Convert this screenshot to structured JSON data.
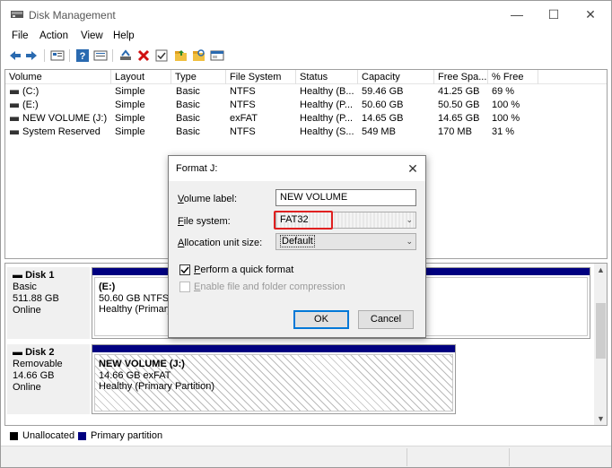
{
  "window": {
    "title": "Disk Management",
    "minimize": "—",
    "maximize": "☐",
    "close": "✕"
  },
  "menu": [
    "File",
    "Action",
    "View",
    "Help"
  ],
  "toolbar_icons": [
    "back-arrow-icon",
    "forward-arrow-icon",
    "disk-list-icon",
    "help-icon",
    "properties-icon",
    "connect-icon",
    "delete-icon",
    "checkmark-icon",
    "folder-up-icon",
    "folder-search-icon",
    "console-icon"
  ],
  "volume_list": {
    "columns": [
      "Volume",
      "Layout",
      "Type",
      "File System",
      "Status",
      "Capacity",
      "Free Spa...",
      "% Free"
    ],
    "rows": [
      [
        "(C:)",
        "Simple",
        "Basic",
        "NTFS",
        "Healthy (B...",
        "59.46 GB",
        "41.25 GB",
        "69 %"
      ],
      [
        "(E:)",
        "Simple",
        "Basic",
        "NTFS",
        "Healthy (P...",
        "50.60 GB",
        "50.50 GB",
        "100 %"
      ],
      [
        "NEW VOLUME (J:)",
        "Simple",
        "Basic",
        "exFAT",
        "Healthy (P...",
        "14.65 GB",
        "14.65 GB",
        "100 %"
      ],
      [
        "System Reserved",
        "Simple",
        "Basic",
        "NTFS",
        "Healthy (S...",
        "549 MB",
        "170 MB",
        "31 %"
      ]
    ]
  },
  "disks": [
    {
      "name": "Disk 1",
      "type": "Basic",
      "size": "511.88 GB",
      "status": "Online",
      "partition": {
        "name": "(E:)",
        "detail": "50.60 GB NTFS",
        "status": "Healthy (Primary"
      }
    },
    {
      "name": "Disk 2",
      "type": "Removable",
      "size": "14.66 GB",
      "status": "Online",
      "partition": {
        "name": "NEW VOLUME  (J:)",
        "detail": "14.66 GB exFAT",
        "status": "Healthy (Primary Partition)"
      }
    }
  ],
  "legend": {
    "unallocated": "Unallocated",
    "unallocated_color": "#000000",
    "primary": "Primary partition",
    "primary_color": "#000080"
  },
  "dialog": {
    "title": "Format J:",
    "close": "✕",
    "volume_label": {
      "label_first": "V",
      "label_rest": "olume label:",
      "value": "NEW VOLUME"
    },
    "file_system": {
      "label_first": "F",
      "label_rest": "ile system:",
      "value": "FAT32"
    },
    "allocation": {
      "label_first": "A",
      "label_rest": "llocation unit size:",
      "value": "Default"
    },
    "quick_format": {
      "label_first": "P",
      "label_rest": "erform a quick format",
      "checked": true
    },
    "compression": {
      "label_first": "E",
      "label_rest": "nable file and folder compression",
      "checked": false
    },
    "ok": "OK",
    "cancel": "Cancel",
    "highlight_color": "#e02020"
  }
}
